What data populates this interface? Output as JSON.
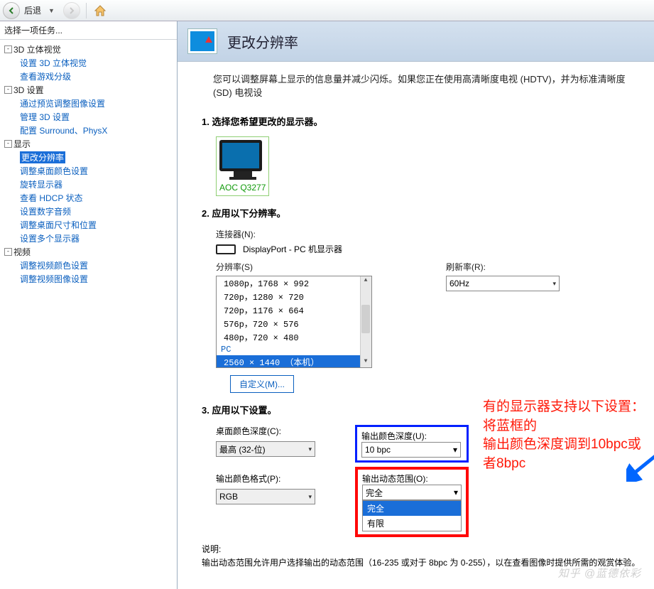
{
  "toolbar": {
    "back": "后退",
    "home": "home"
  },
  "sidebar": {
    "taskHeader": "选择一项任务...",
    "groups": [
      {
        "label": "3D 立体视觉",
        "items": [
          "设置 3D 立体视觉",
          "查看游戏分级"
        ]
      },
      {
        "label": "3D 设置",
        "items": [
          "通过预览调整图像设置",
          "管理 3D 设置",
          "配置 Surround、PhysX"
        ]
      },
      {
        "label": "显示",
        "items": [
          "更改分辨率",
          "调整桌面颜色设置",
          "旋转显示器",
          "查看 HDCP 状态",
          "设置数字音频",
          "调整桌面尺寸和位置",
          "设置多个显示器"
        ],
        "selected": 0
      },
      {
        "label": "视频",
        "items": [
          "调整视频颜色设置",
          "调整视频图像设置"
        ]
      }
    ]
  },
  "page": {
    "title": "更改分辨率",
    "desc": "您可以调整屏幕上显示的信息量并减少闪烁。如果您正在使用高清晰度电视 (HDTV)，并为标准清晰度 (SD) 电视设"
  },
  "sec1": {
    "title": "1.   选择您希望更改的显示器。",
    "monitor": "AOC Q3277"
  },
  "sec2": {
    "title": "2.   应用以下分辨率。",
    "connectorLabel": "连接器(N):",
    "connectorValue": "DisplayPort - PC 机显示器",
    "resolutionLabel": "分辨率(S)",
    "refreshLabel": "刷新率(R):",
    "refreshValue": "60Hz",
    "resItems": [
      "1080p，1768 × 992",
      "720p，1280 × 720",
      "720p，1176 × 664",
      "576p，720 × 576",
      "480p，720 × 480"
    ],
    "resGroup": "PC",
    "resSelected": "  2560 × 1440 （本机）",
    "customBtn": "自定义(M)..."
  },
  "annotation": {
    "line1": "有的显示器支持以下设置：将蓝框的",
    "line2": "输出颜色深度调到10bpc或者8bpc"
  },
  "sec3": {
    "title": "3.   应用以下设置。",
    "desktopDepthLabel": "桌面颜色深度(C):",
    "desktopDepthValue": "最高 (32-位)",
    "outputDepthLabel": "输出颜色深度(U):",
    "outputDepthValue": "10 bpc",
    "outputFormatLabel": "输出颜色格式(P):",
    "outputFormatValue": "RGB",
    "outputRangeLabel": "输出动态范围(O):",
    "outputRangeValue": "完全",
    "rangeOpt1": "完全",
    "rangeOpt2": "有限"
  },
  "explain": {
    "label": "说明:",
    "text": "输出动态范围允许用户选择输出的动态范围（16-235 或对于 8bpc 为 0-255），以在查看图像时提供所需的观赏体验。"
  },
  "watermark": "知乎 @蓝德依彩"
}
